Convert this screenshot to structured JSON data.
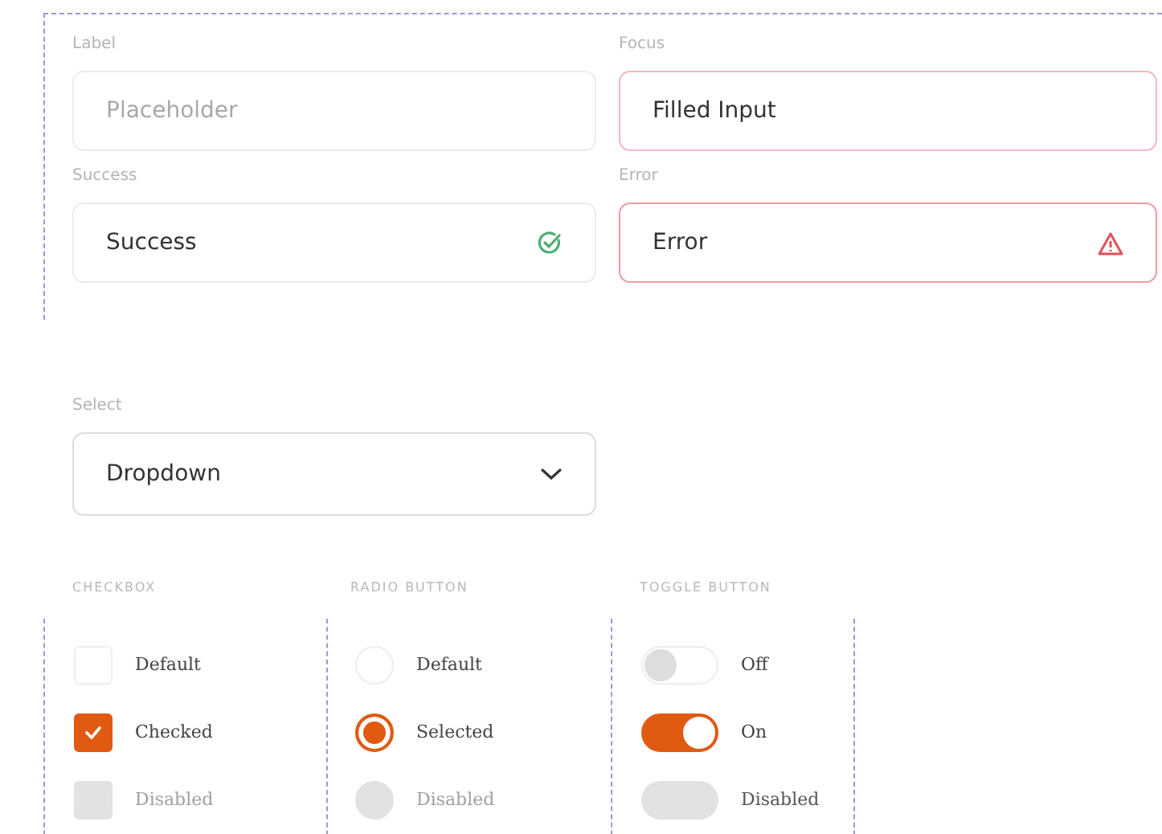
{
  "fields": [
    {
      "kind": "default",
      "label": "Label",
      "placeholder": "Placeholder"
    },
    {
      "kind": "focus",
      "label": "Focus",
      "value": "Filled Input"
    },
    {
      "kind": "success",
      "label": "Success",
      "value": "Success"
    },
    {
      "kind": "error",
      "label": "Error",
      "value": "Error"
    }
  ],
  "select": {
    "label": "Select",
    "value": "Dropdown"
  },
  "groups": [
    {
      "kind": "checkbox",
      "title": "CHECKBOX",
      "items": [
        {
          "label": "Default",
          "checked": false,
          "disabled": false
        },
        {
          "label": "Checked",
          "checked": true,
          "disabled": false
        },
        {
          "label": "Disabled",
          "checked": false,
          "disabled": true
        }
      ]
    },
    {
      "kind": "radio",
      "title": "RADIO BUTTON",
      "items": [
        {
          "label": "Default",
          "checked": false,
          "disabled": false
        },
        {
          "label": "Selected",
          "checked": true,
          "disabled": false
        },
        {
          "label": "Disabled",
          "checked": false,
          "disabled": true
        }
      ]
    },
    {
      "kind": "toggle",
      "title": "TOGGLE BUTTON",
      "items": [
        {
          "label": "Off",
          "checked": false,
          "disabled": false
        },
        {
          "label": "On",
          "checked": true,
          "disabled": false
        },
        {
          "label": "Disabled",
          "checked": false,
          "disabled": true
        }
      ]
    }
  ]
}
